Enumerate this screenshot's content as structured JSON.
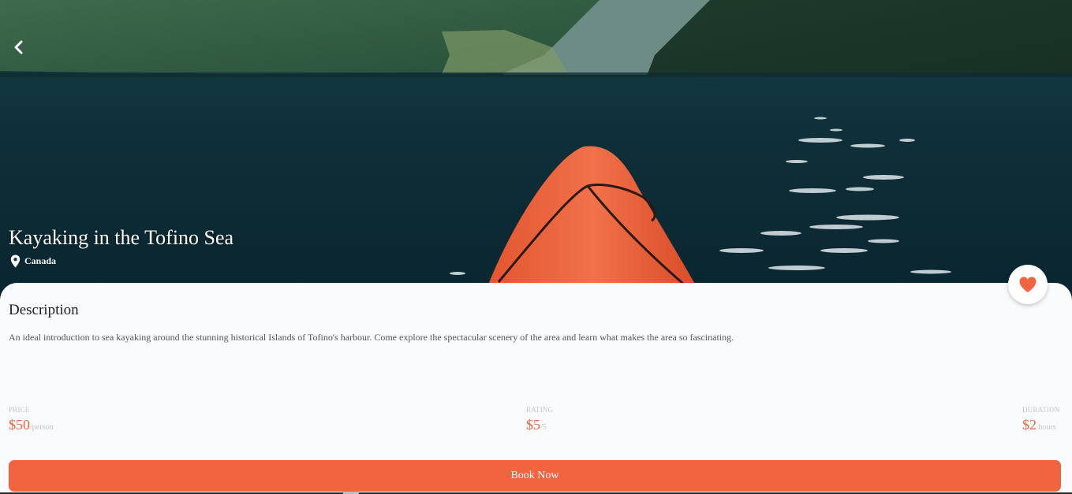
{
  "hero": {
    "title": "Kayaking in the Tofino Sea",
    "location": "Canada",
    "back_icon": "chevron-left-icon",
    "location_icon": "map-pin-icon"
  },
  "favorite": {
    "icon": "heart-icon",
    "color": "#f26440"
  },
  "description": {
    "heading": "Description",
    "text": "An ideal introduction to sea kayaking around the stunning historical Islands of Tofino's harbour. Come explore the spectacular scenery of the area and learn what makes the area so fascinating."
  },
  "stats": {
    "price": {
      "label": "PRICE",
      "value": "$50",
      "unit": "/person"
    },
    "rating": {
      "label": "RATING",
      "value": "$5",
      "unit": "/5"
    },
    "duration": {
      "label": "DURATION",
      "value": "$2",
      "unit": " hours"
    }
  },
  "actions": {
    "book_label": "Book Now"
  },
  "colors": {
    "accent": "#f26440",
    "water": "#0d2a33"
  }
}
